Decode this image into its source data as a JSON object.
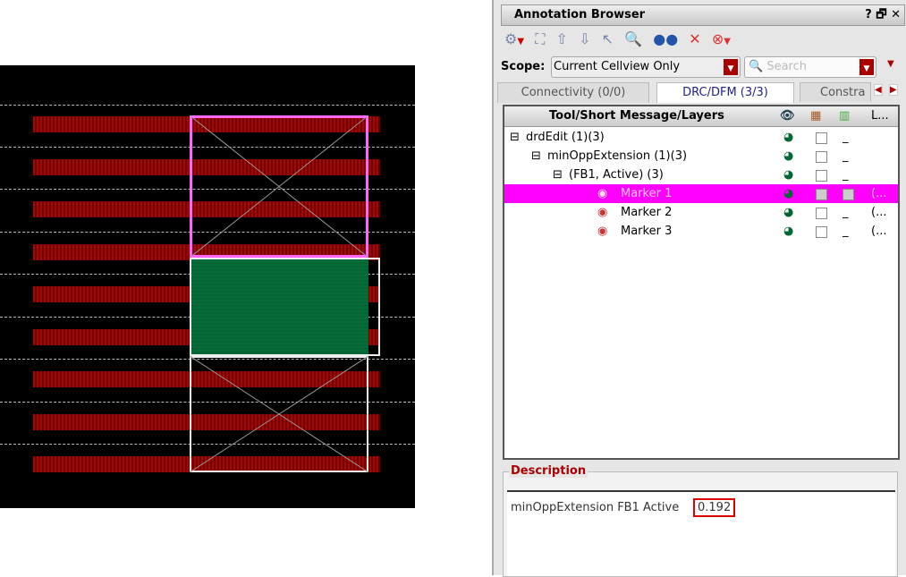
{
  "canvas": {
    "stripe_color": "#b00000",
    "marker_color": "#ff66ff",
    "fill_color": "#0a6b3a"
  },
  "panel": {
    "title": "Annotation Browser",
    "title_buttons": [
      "?",
      "🗗",
      "✕"
    ],
    "scope_label": "Scope:",
    "scope_value": "Current Cellview Only",
    "search_placeholder": "Search",
    "tabs": [
      {
        "label": "Connectivity (0/0)"
      },
      {
        "label": "DRC/DFM (3/3)"
      },
      {
        "label": "Constra"
      }
    ],
    "tree_header": "Tool/Short Message/Layers",
    "col_last": "L...",
    "rows": [
      {
        "label": "drdEdit (1)(3)",
        "extra": ""
      },
      {
        "label": "minOppExtension (1)(3)",
        "extra": ""
      },
      {
        "label": "(FB1, Active) (3)",
        "extra": ""
      },
      {
        "label": "Marker 1",
        "extra": "(..."
      },
      {
        "label": "Marker 2",
        "extra": "(..."
      },
      {
        "label": "Marker 3",
        "extra": "(..."
      }
    ],
    "selected_color": "#ff00ff",
    "description_title": "Description",
    "description_text": "minOppExtension FB1 Active",
    "description_value": "0.192"
  }
}
